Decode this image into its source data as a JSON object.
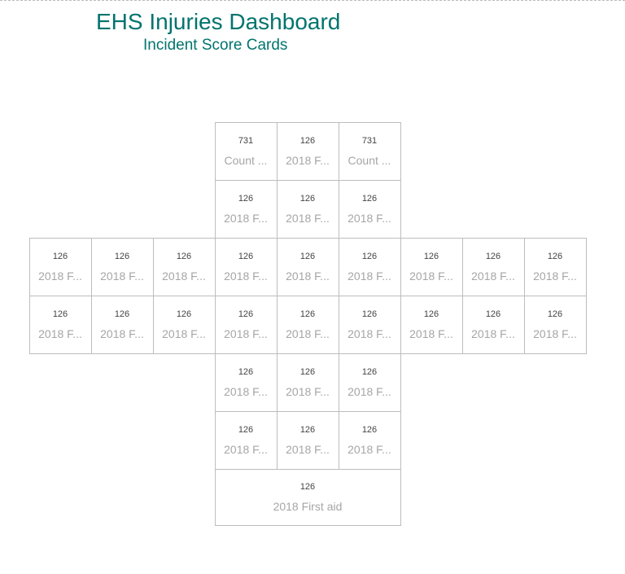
{
  "header": {
    "title": "EHS Injuries Dashboard",
    "subtitle": "Incident Score Cards"
  },
  "cards": {
    "r0c3": {
      "value": "731",
      "label": "Count ..."
    },
    "r0c4": {
      "value": "126",
      "label": "2018 F..."
    },
    "r0c5": {
      "value": "731",
      "label": "Count ..."
    },
    "r1c3": {
      "value": "126",
      "label": "2018 F..."
    },
    "r1c4": {
      "value": "126",
      "label": "2018 F..."
    },
    "r1c5": {
      "value": "126",
      "label": "2018 F..."
    },
    "r2c0": {
      "value": "126",
      "label": "2018 F..."
    },
    "r2c1": {
      "value": "126",
      "label": "2018 F..."
    },
    "r2c2": {
      "value": "126",
      "label": "2018 F..."
    },
    "r2c3": {
      "value": "126",
      "label": "2018 F..."
    },
    "r2c4": {
      "value": "126",
      "label": "2018 F..."
    },
    "r2c5": {
      "value": "126",
      "label": "2018 F..."
    },
    "r2c6": {
      "value": "126",
      "label": "2018 F..."
    },
    "r2c7": {
      "value": "126",
      "label": "2018 F..."
    },
    "r2c8": {
      "value": "126",
      "label": "2018 F..."
    },
    "r3c0": {
      "value": "126",
      "label": "2018 F..."
    },
    "r3c1": {
      "value": "126",
      "label": "2018 F..."
    },
    "r3c2": {
      "value": "126",
      "label": "2018 F..."
    },
    "r3c3": {
      "value": "126",
      "label": "2018 F..."
    },
    "r3c4": {
      "value": "126",
      "label": "2018 F..."
    },
    "r3c5": {
      "value": "126",
      "label": "2018 F..."
    },
    "r3c6": {
      "value": "126",
      "label": "2018 F..."
    },
    "r3c7": {
      "value": "126",
      "label": "2018 F..."
    },
    "r3c8": {
      "value": "126",
      "label": "2018 F..."
    },
    "r4c3": {
      "value": "126",
      "label": "2018 F..."
    },
    "r4c4": {
      "value": "126",
      "label": "2018 F..."
    },
    "r4c5": {
      "value": "126",
      "label": "2018 F..."
    },
    "r5c3": {
      "value": "126",
      "label": "2018 F..."
    },
    "r5c4": {
      "value": "126",
      "label": "2018 F..."
    },
    "r5c5": {
      "value": "126",
      "label": "2018 F..."
    },
    "r6wide": {
      "value": "126",
      "label": "2018 First aid"
    }
  }
}
